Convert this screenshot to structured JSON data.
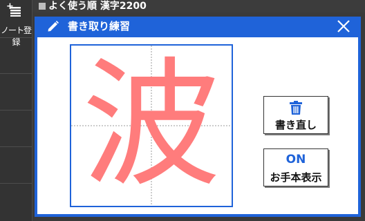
{
  "sidebar": {
    "note_register_label": "ノート登録"
  },
  "topbar": {
    "title": "よく使う順 漢字2200"
  },
  "dialog": {
    "title": "書き取り練習",
    "kanji": "波",
    "erase_button_label": "書き直し",
    "model_toggle_state": "ON",
    "model_button_label": "お手本表示"
  },
  "colors": {
    "accent": "#1f63d9",
    "kanji": "#ff7c7c",
    "background": "#3a3a3a"
  },
  "icons": {
    "note_add": "note-add-icon",
    "pencil": "pencil-icon",
    "close": "close-icon",
    "trash": "trash-icon"
  }
}
